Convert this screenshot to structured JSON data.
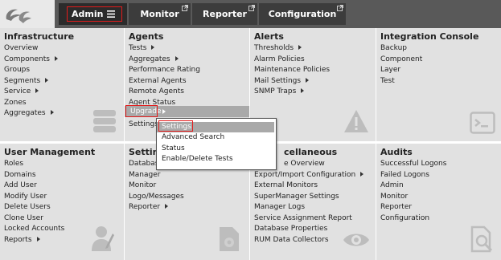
{
  "topbar": {
    "tabs": [
      {
        "label": "Admin"
      },
      {
        "label": "Monitor"
      },
      {
        "label": "Reporter"
      },
      {
        "label": "Configuration"
      }
    ]
  },
  "panels": {
    "infrastructure": {
      "title": "Infrastructure",
      "items": [
        "Overview",
        "Components",
        "Groups",
        "Segments",
        "Service",
        "Zones",
        "Aggregates"
      ]
    },
    "agents": {
      "title": "Agents",
      "items": [
        "Tests",
        "Aggregates",
        "Performance Rating",
        "External Agents",
        "Remote Agents",
        "Agent Status",
        "Upgrade",
        "Settings"
      ]
    },
    "alerts": {
      "title": "Alerts",
      "items": [
        "Thresholds",
        "Alarm Policies",
        "Maintenance Policies",
        "Mail Settings",
        "SNMP Traps"
      ]
    },
    "integration": {
      "title": "Integration Console",
      "items": [
        "Backup",
        "Component",
        "Layer",
        "Test"
      ]
    },
    "user_mgmt": {
      "title": "User Management",
      "items": [
        "Roles",
        "Domains",
        "Add User",
        "Modify User",
        "Delete Users",
        "Clone User",
        "Locked Accounts",
        "Reports"
      ]
    },
    "settings": {
      "title": "Setting",
      "items": [
        "Databas",
        "Manager",
        "Monitor",
        "Logo/Messages",
        "Reporter"
      ]
    },
    "misc": {
      "title": "cellaneous",
      "items": [
        "e Overview",
        "Export/Import Configuration",
        "External Monitors",
        "SuperManager Settings",
        "Manager Logs",
        "Service Assignment Report",
        "Database Properties",
        "RUM Data Collectors"
      ]
    },
    "audits": {
      "title": "Audits",
      "items": [
        "Successful Logons",
        "Failed Logons",
        "Admin",
        "Monitor",
        "Reporter",
        "Configuration"
      ]
    }
  },
  "popup": {
    "items": [
      "Settings",
      "Advanced Search",
      "Status",
      "Enable/Delete Tests"
    ]
  }
}
